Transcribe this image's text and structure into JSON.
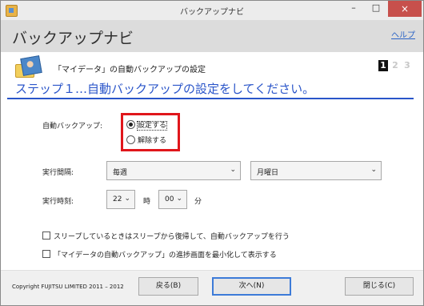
{
  "window": {
    "title": "バックアップナビ",
    "min_glyph": "–",
    "max_glyph": "□",
    "close_glyph": "×",
    "icon": "app-icon"
  },
  "header": {
    "app_title": "バックアップナビ",
    "help": "ヘルプ"
  },
  "section": {
    "title": "「マイデータ」の自動バックアップの設定",
    "icon": "my-data-photo-icon",
    "steps": [
      "1",
      "2",
      "3"
    ],
    "active_step": 1
  },
  "step_heading": "ステップ１…自動バックアップの設定をしてください。",
  "form": {
    "auto_backup_label": "自動バックアップ:",
    "radio_options": [
      {
        "label": "設定する",
        "selected": true
      },
      {
        "label": "解除する",
        "selected": false
      }
    ],
    "highlight_color": "#e0161b",
    "interval_label": "実行間隔:",
    "interval_value": "毎週",
    "day_value": "月曜日",
    "time_label": "実行時刻:",
    "hour_value": "22",
    "hour_unit": "時",
    "minute_value": "00",
    "minute_unit": "分",
    "dropdown_glyph": "⌄",
    "checkbox_sleep": "スリープしているときはスリープから復帰して、自動バックアップを行う",
    "checkbox_minimize": "「マイデータの自動バックアップ」の進捗画面を最小化して表示する"
  },
  "footer": {
    "copyright": "Copyright FUJITSU LIMITED 2011 – 2012",
    "back": "戻る(B)",
    "next": "次へ(N)",
    "close": "閉じる(C)"
  },
  "colors": {
    "accent": "#2a55c9",
    "link": "#2a63c6"
  }
}
